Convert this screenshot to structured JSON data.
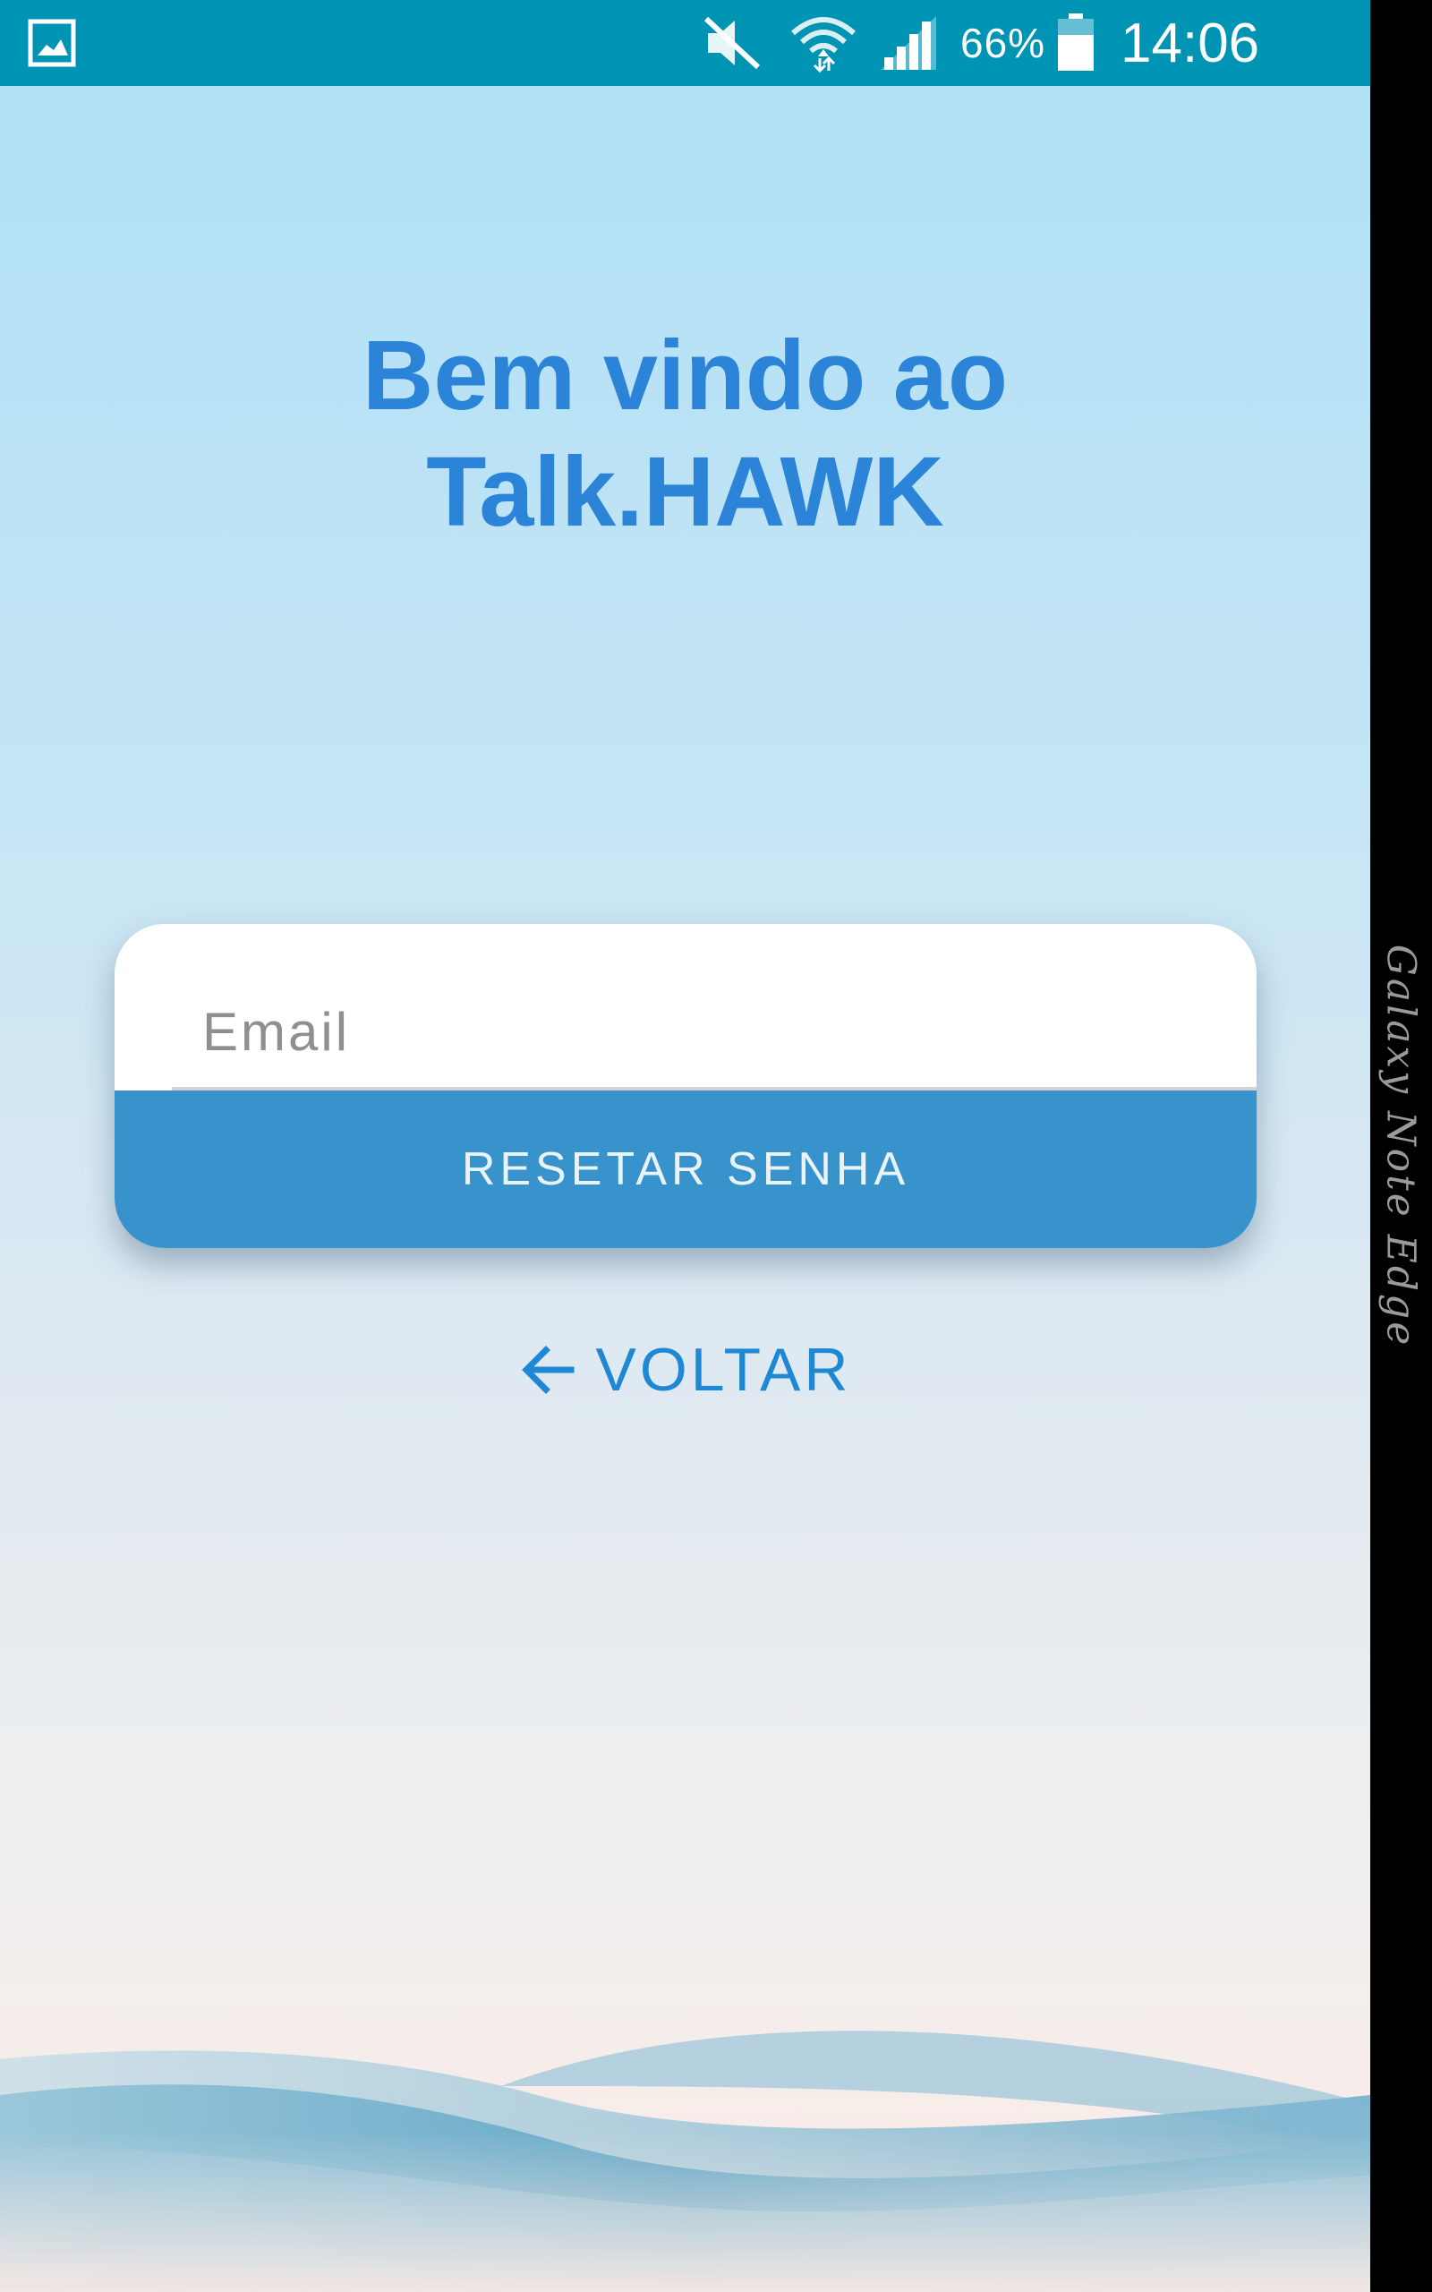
{
  "status_bar": {
    "battery_percent": "66%",
    "time": "14:06",
    "icons": [
      "gallery-icon",
      "mute-icon",
      "wifi-icon",
      "signal-icon",
      "battery-icon"
    ]
  },
  "welcome": {
    "line1": "Bem vindo ao",
    "line2": "Talk.HAWK"
  },
  "form": {
    "email_placeholder": "Email",
    "email_value": "",
    "reset_button_label": "RESETAR SENHA"
  },
  "back": {
    "label": "VOLTAR",
    "icon": "arrow-left-icon"
  },
  "device": {
    "edge_label": "Galaxy Note Edge"
  },
  "colors": {
    "status_bar": "#0094b4",
    "title": "#2b84d8",
    "button": "#3892cb",
    "link": "#1e88d4"
  }
}
